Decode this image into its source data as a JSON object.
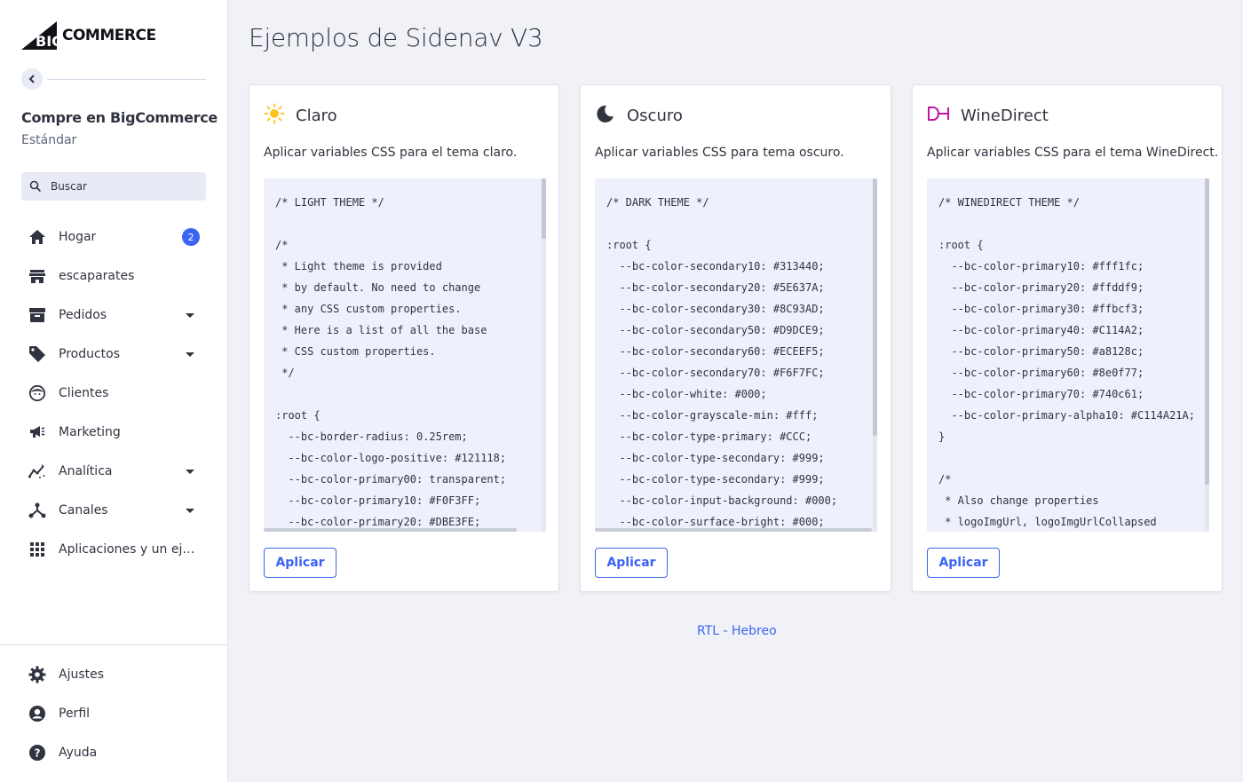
{
  "sidebar": {
    "logo": "BIGCOMMERCE",
    "store_name": "Compre en BigCommerce",
    "store_plan": "Estándar",
    "search_placeholder": "Buscar",
    "nav": [
      {
        "label": "Hogar",
        "icon": "home-icon",
        "badge": "2"
      },
      {
        "label": "escaparates",
        "icon": "storefront-icon"
      },
      {
        "label": "Pedidos",
        "icon": "orders-icon",
        "expandable": true
      },
      {
        "label": "Productos",
        "icon": "tag-icon",
        "expandable": true
      },
      {
        "label": "Clientes",
        "icon": "customers-icon"
      },
      {
        "label": "Marketing",
        "icon": "megaphone-icon"
      },
      {
        "label": "Analítica",
        "icon": "analytics-icon",
        "expandable": true
      },
      {
        "label": "Canales",
        "icon": "channels-icon",
        "expandable": true
      },
      {
        "label": "Aplicaciones y un ejemplo",
        "icon": "apps-grid-icon"
      }
    ],
    "bottom_nav": [
      {
        "label": "Ajustes",
        "icon": "gear-icon"
      },
      {
        "label": "Perfil",
        "icon": "profile-icon"
      },
      {
        "label": "Ayuda",
        "icon": "help-icon"
      }
    ]
  },
  "main": {
    "title": "Ejemplos de Sidenav V3",
    "cards": [
      {
        "title": "Claro",
        "icon": "sun-icon",
        "description": "Aplicar variables CSS para el tema claro.",
        "code": "/* LIGHT THEME */\n\n/*\n * Light theme is provided\n * by default. No need to change\n * any CSS custom properties.\n * Here is a list of all the base\n * CSS custom properties.\n */\n\n:root {\n  --bc-border-radius: 0.25rem;\n  --bc-color-logo-positive: #121118;\n  --bc-color-primary00: transparent;\n  --bc-color-primary10: #F0F3FF;\n  --bc-color-primary20: #DBE3FE;",
        "button": "Aplicar"
      },
      {
        "title": "Oscuro",
        "icon": "moon-icon",
        "description": "Aplicar variables CSS para tema oscuro.",
        "code": "/* DARK THEME */\n\n:root {\n  --bc-color-secondary10: #313440;\n  --bc-color-secondary20: #5E637A;\n  --bc-color-secondary30: #8C93AD;\n  --bc-color-secondary50: #D9DCE9;\n  --bc-color-secondary60: #ECEEF5;\n  --bc-color-secondary70: #F6F7FC;\n  --bc-color-white: #000;\n  --bc-color-grayscale-min: #fff;\n  --bc-color-type-primary: #CCC;\n  --bc-color-type-secondary: #999;\n  --bc-color-type-secondary: #999;\n  --bc-color-input-background: #000;\n  --bc-color-surface-bright: #000;",
        "button": "Aplicar"
      },
      {
        "title": "WineDirect",
        "icon": "winedirect-logo-icon",
        "description": "Aplicar variables CSS para el tema WineDirect.",
        "code": "/* WINEDIRECT THEME */\n\n:root {\n  --bc-color-primary10: #fff1fc;\n  --bc-color-primary20: #ffddf9;\n  --bc-color-primary30: #ffbcf3;\n  --bc-color-primary40: #C114A2;\n  --bc-color-primary50: #a8128c;\n  --bc-color-primary60: #8e0f77;\n  --bc-color-primary70: #740c61;\n  --bc-color-primary-alpha10: #C114A21A;\n}\n\n/*\n * Also change properties\n * logoImgUrl, logoImgUrlCollapsed",
        "button": "Aplicar"
      }
    ],
    "footer_link": "RTL - Hebreo"
  },
  "colors": {
    "accent": "#3c64f4",
    "text": "#313440",
    "background": "#f1f2f7",
    "sun": "#ffc51f",
    "winedirect": "#c114a2"
  }
}
